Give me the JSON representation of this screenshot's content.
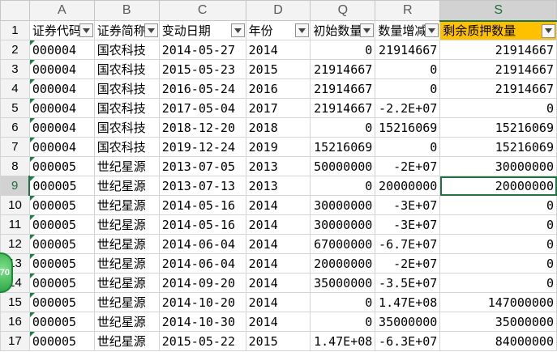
{
  "columns": [
    "A",
    "B",
    "C",
    "D",
    "Q",
    "R",
    "S"
  ],
  "headers": [
    "证券代码",
    "证券简称",
    "变动日期",
    "年份",
    "初始数量",
    "数量增减",
    "剩余质押数量"
  ],
  "rows": [
    {
      "num": "1"
    },
    {
      "num": "2",
      "cells": [
        "000004",
        "国农科技",
        "2014-05-27",
        "2014",
        "0",
        "21914667",
        "21914667"
      ]
    },
    {
      "num": "3",
      "cells": [
        "000004",
        "国农科技",
        "2015-05-23",
        "2015",
        "21914667",
        "0",
        "21914667"
      ]
    },
    {
      "num": "4",
      "cells": [
        "000004",
        "国农科技",
        "2016-05-24",
        "2016",
        "21914667",
        "0",
        "21914667"
      ]
    },
    {
      "num": "5",
      "cells": [
        "000004",
        "国农科技",
        "2017-05-04",
        "2017",
        "21914667",
        "-2.2E+07",
        "0"
      ]
    },
    {
      "num": "6",
      "cells": [
        "000004",
        "国农科技",
        "2018-12-20",
        "2018",
        "0",
        "15216069",
        "15216069"
      ]
    },
    {
      "num": "7",
      "cells": [
        "000004",
        "国农科技",
        "2019-12-24",
        "2019",
        "15216069",
        "0",
        "15216069"
      ]
    },
    {
      "num": "8",
      "cells": [
        "000005",
        "世纪星源",
        "2013-07-05",
        "2013",
        "50000000",
        "-2E+07",
        "30000000"
      ]
    },
    {
      "num": "9",
      "cells": [
        "000005",
        "世纪星源",
        "2013-07-13",
        "2013",
        "0",
        "20000000",
        "20000000"
      ]
    },
    {
      "num": "10",
      "cells": [
        "000005",
        "世纪星源",
        "2014-05-16",
        "2014",
        "30000000",
        "-3E+07",
        "0"
      ]
    },
    {
      "num": "11",
      "cells": [
        "000005",
        "世纪星源",
        "2014-05-16",
        "2014",
        "30000000",
        "-3E+07",
        "0"
      ]
    },
    {
      "num": "12",
      "cells": [
        "000005",
        "世纪星源",
        "2014-06-04",
        "2014",
        "67000000",
        "-6.7E+07",
        "0"
      ]
    },
    {
      "num": "13",
      "cells": [
        "000005",
        "世纪星源",
        "2014-06-04",
        "2014",
        "20000000",
        "-2E+07",
        "0"
      ]
    },
    {
      "num": "14",
      "cells": [
        "000005",
        "世纪星源",
        "2014-09-20",
        "2014",
        "35000000",
        "-3.5E+07",
        "0"
      ]
    },
    {
      "num": "15",
      "cells": [
        "000005",
        "世纪星源",
        "2014-10-20",
        "2014",
        "0",
        "1.47E+08",
        "147000000"
      ]
    },
    {
      "num": "16",
      "cells": [
        "000005",
        "世纪星源",
        "2014-10-30",
        "2014",
        "0",
        "35000000",
        "35000000"
      ]
    },
    {
      "num": "17",
      "cells": [
        "000005",
        "世纪星源",
        "2015-05-22",
        "2015",
        "1.47E+08",
        "-6.3E+07",
        "84000000"
      ]
    }
  ],
  "badge": "70",
  "colors": {
    "header_highlight": "#ffc000",
    "selection": "#217346"
  }
}
